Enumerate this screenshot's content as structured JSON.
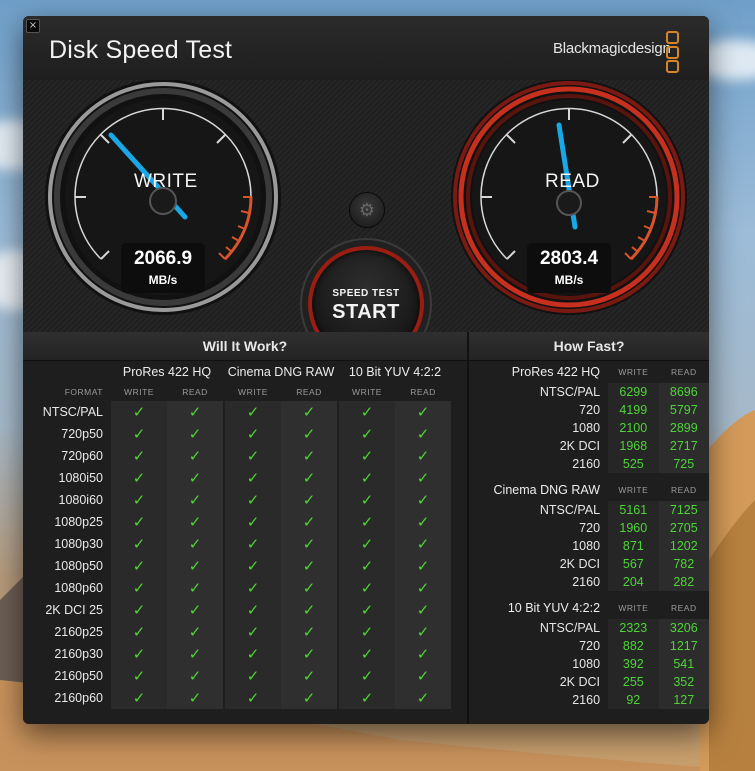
{
  "app": {
    "title": "Disk Speed Test",
    "brand": "Blackmagicdesign",
    "close_label": "×"
  },
  "gauges": {
    "write": {
      "label": "WRITE",
      "value": "2066.9",
      "unit": "MB/s"
    },
    "read": {
      "label": "READ",
      "value": "2803.4",
      "unit": "MB/s"
    }
  },
  "start_button": {
    "small": "SPEED TEST",
    "big": "START"
  },
  "settings_icon": "gear-icon",
  "will_it_work": {
    "title": "Will It Work?",
    "format_header": "FORMAT",
    "groups": [
      "ProRes 422 HQ",
      "Cinema DNG RAW",
      "10 Bit YUV 4:2:2"
    ],
    "col_write": "WRITE",
    "col_read": "READ",
    "check": "✓",
    "formats": [
      "NTSC/PAL",
      "720p50",
      "720p60",
      "1080i50",
      "1080i60",
      "1080p25",
      "1080p30",
      "1080p50",
      "1080p60",
      "2K DCI 25",
      "2160p25",
      "2160p30",
      "2160p50",
      "2160p60"
    ]
  },
  "how_fast": {
    "title": "How Fast?",
    "col_write": "WRITE",
    "col_read": "READ",
    "groups": [
      {
        "name": "ProRes 422 HQ",
        "rows": [
          {
            "label": "NTSC/PAL",
            "write": "6299",
            "read": "8696"
          },
          {
            "label": "720",
            "write": "4199",
            "read": "5797"
          },
          {
            "label": "1080",
            "write": "2100",
            "read": "2899"
          },
          {
            "label": "2K DCI",
            "write": "1968",
            "read": "2717"
          },
          {
            "label": "2160",
            "write": "525",
            "read": "725"
          }
        ]
      },
      {
        "name": "Cinema DNG RAW",
        "rows": [
          {
            "label": "NTSC/PAL",
            "write": "5161",
            "read": "7125"
          },
          {
            "label": "720",
            "write": "1960",
            "read": "2705"
          },
          {
            "label": "1080",
            "write": "871",
            "read": "1202"
          },
          {
            "label": "2K DCI",
            "write": "567",
            "read": "782"
          },
          {
            "label": "2160",
            "write": "204",
            "read": "282"
          }
        ]
      },
      {
        "name": "10 Bit YUV 4:2:2",
        "rows": [
          {
            "label": "NTSC/PAL",
            "write": "2323",
            "read": "3206"
          },
          {
            "label": "720",
            "write": "882",
            "read": "1217"
          },
          {
            "label": "1080",
            "write": "392",
            "read": "541"
          },
          {
            "label": "2K DCI",
            "write": "255",
            "read": "352"
          },
          {
            "label": "2160",
            "write": "92",
            "read": "127"
          }
        ]
      }
    ]
  },
  "colors": {
    "accent_green": "#4ed437",
    "needle_blue": "#1aa7e6",
    "read_ring_red": "#b8261a",
    "brand_orange": "#d6852a"
  }
}
